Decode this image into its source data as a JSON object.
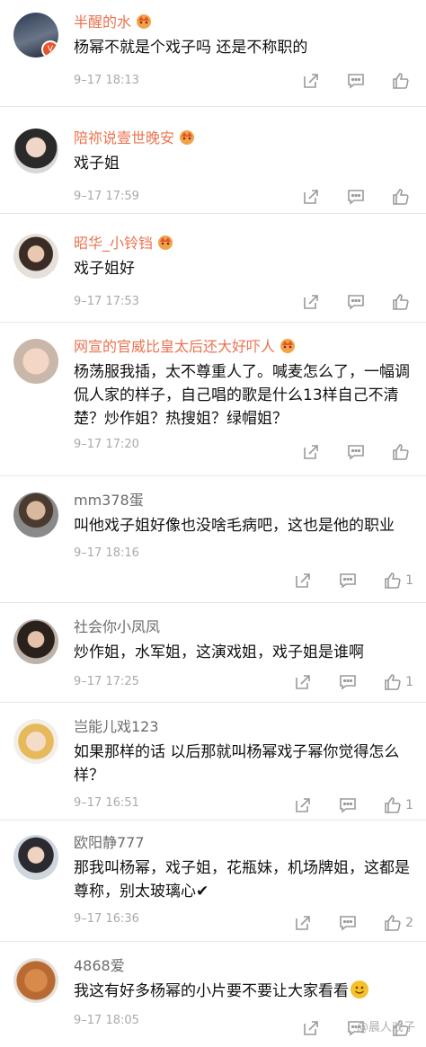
{
  "comments": [
    {
      "name": "半醒的水",
      "text": "杨幂不就是个戏子吗 还是不称职的",
      "time": "9–17 18:13",
      "likes": ""
    },
    {
      "name": "陪祢说壹世晚安",
      "text": "戏子姐",
      "time": "9–17 17:59",
      "likes": ""
    },
    {
      "name": "昭华_小铃铛",
      "text": "戏子姐好",
      "time": "9–17 17:53",
      "likes": ""
    },
    {
      "name": "网宣的官威比皇太后还大好吓人",
      "text": "杨荡服我插，太不尊重人了。喊麦怎么了，一幅调侃人家的样子，自己唱的歌是什么13样自己不清楚？炒作姐？热搜姐？绿帽姐？",
      "time": "9–17 17:20",
      "likes": ""
    },
    {
      "name": "mm378蛋",
      "text": "叫他戏子姐好像也没啥毛病吧，这也是他的职业",
      "time": "9–17 18:16",
      "likes": "1"
    },
    {
      "name": "社会你小凤凤",
      "text": "炒作姐，水军姐，这演戏姐，戏子姐是谁啊",
      "time": "9–17 17:25",
      "likes": "1"
    },
    {
      "name": "岂能儿戏123",
      "text": "如果那样的话 以后那就叫杨幂戏子幂你觉得怎么样？",
      "time": "9–17 16:51",
      "likes": "1"
    },
    {
      "name": "欧阳静777",
      "text": "那我叫杨幂，戏子姐，花瓶妹，机场牌姐，这都是尊称，别太玻璃心✔",
      "time": "9–17 16:36",
      "likes": "2"
    },
    {
      "name": "4868爱",
      "text": "我这有好多杨幂的小片要不要让大家看看",
      "time": "9–17 18:05",
      "likes": ""
    }
  ],
  "avatar_badge": "V",
  "watermark": "@晨人戏子",
  "colors": {
    "gold_name": "#eb7350",
    "plain_name": "#6b6b6b",
    "time": "#aaaaaa",
    "icon": "#9a9a9a",
    "badge": "#e8542a"
  },
  "icons": [
    "share-icon",
    "comment-icon",
    "like-icon",
    "crown-icon",
    "smile-emoji-icon"
  ]
}
